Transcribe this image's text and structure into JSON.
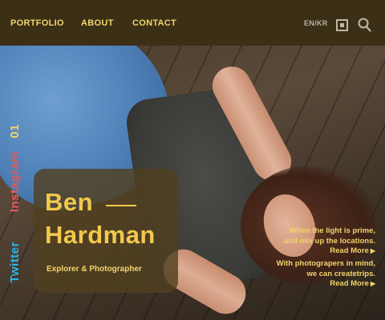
{
  "nav": {
    "portfolio": "PORTFOLIO",
    "about": "ABOUT",
    "contact": "CONTACT",
    "language": "EN/KR"
  },
  "icons": {
    "square": "square-icon",
    "search": "search-icon",
    "arrow": "triangle-right-icon"
  },
  "social": {
    "number": "01",
    "instagram": "Instagram",
    "twitter": "Twitter"
  },
  "profile": {
    "first_name": "Ben",
    "last_name": "Hardman",
    "role": "Explorer & Photographer"
  },
  "quotes": [
    {
      "line1": "When the light is prime,",
      "line2": "and mix up the locations.",
      "link": "Read More"
    },
    {
      "line1": "With photograpers in mind,",
      "line2": "we can createtrips.",
      "link": "Read More"
    }
  ],
  "colors": {
    "accent": "#f2d46a",
    "nav_bg": "#3b2f16",
    "instagram": "#e05a5a",
    "twitter": "#2ab6ea"
  }
}
